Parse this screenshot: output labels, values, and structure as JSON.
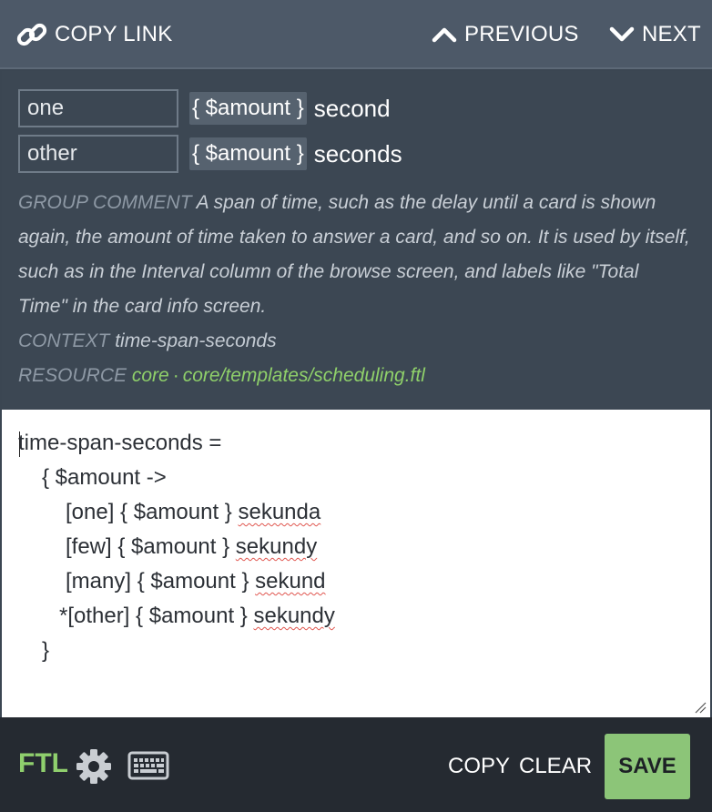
{
  "topbar": {
    "copy_link": "COPY LINK",
    "previous": "PREVIOUS",
    "next": "NEXT"
  },
  "original": {
    "variants": [
      {
        "label": "one",
        "placeable": "{ $amount }",
        "text": "second"
      },
      {
        "label": "other",
        "placeable": "{ $amount }",
        "text": "seconds"
      }
    ]
  },
  "meta": {
    "group_comment_key": "GROUP COMMENT",
    "group_comment_text": "A span of time, such as the delay until a card is shown again, the amount of time taken to answer a card, and so on. It is used by itself, such as in the Interval column of the browse screen, and labels like \"Total Time\" in the card info screen.",
    "context_key": "CONTEXT",
    "context_value": "time-span-seconds",
    "resource_key": "RESOURCE",
    "resource_project": "core",
    "resource_separator": "·",
    "resource_path": "core/templates/scheduling.ftl"
  },
  "editor": {
    "lines": [
      {
        "code": "time-span-seconds ="
      },
      {
        "code": "{ $amount ->"
      },
      {
        "code": "[one] { $amount } ",
        "word": "sekunda"
      },
      {
        "code": "[few] { $amount } ",
        "word": "sekundy"
      },
      {
        "code": "[many] { $amount } ",
        "word": "sekund"
      },
      {
        "code": "*[other] { $amount } ",
        "word": "sekundy"
      },
      {
        "code": "}"
      }
    ]
  },
  "bottombar": {
    "syntax_label": "FTL",
    "copy": "COPY",
    "clear": "CLEAR",
    "save": "SAVE"
  },
  "icons": {
    "copy_link": "link-icon",
    "previous": "chevron-up-icon",
    "next": "chevron-down-icon",
    "settings": "gear-icon",
    "keyboard": "keyboard-icon",
    "resize": "resize-grip-icon"
  },
  "colors": {
    "accent_green": "#8cc578",
    "link_green": "#8fd06a",
    "spellcheck_red": "#e0564f"
  }
}
